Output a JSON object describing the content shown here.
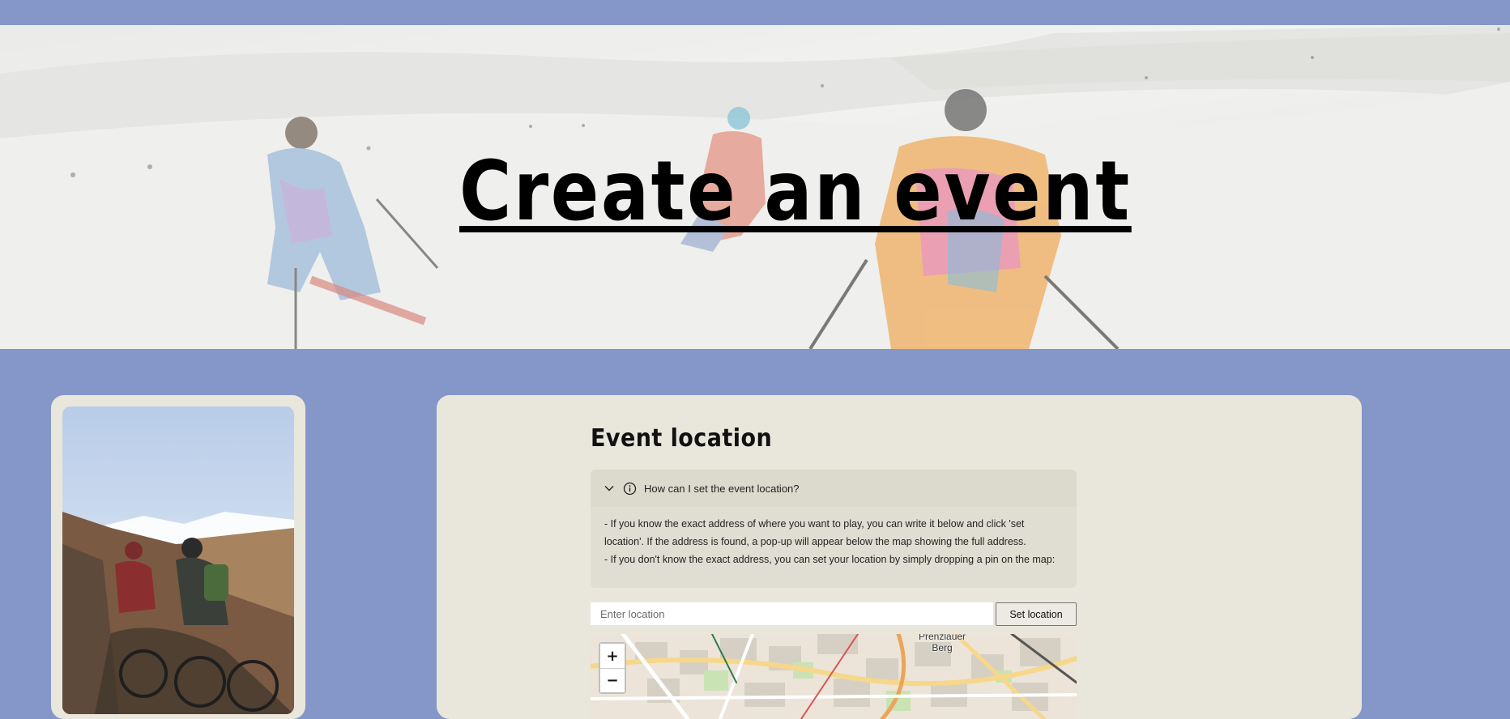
{
  "hero": {
    "title": "Create an event"
  },
  "location": {
    "section_title": "Event location",
    "help": {
      "question": "How can I set the event location?",
      "lines": [
        "- If you know the exact address of where you want to play, you can write it below and click 'set location'. If the address is found, a pop-up will appear below the map showing the full address.",
        "- If you don't know the exact address, you can set your location by simply dropping a pin on the map:"
      ]
    },
    "input_placeholder": "Enter location",
    "set_button": "Set location"
  },
  "map": {
    "zoom_in": "+",
    "zoom_out": "−",
    "labels": [
      "Prenzlauer",
      "Berg"
    ]
  },
  "icons": {
    "chevron": "chevron-down-icon",
    "info": "info-icon"
  },
  "colors": {
    "background": "#8497c8",
    "card": "#e9e6dc",
    "accordion": "#e0ded2"
  }
}
